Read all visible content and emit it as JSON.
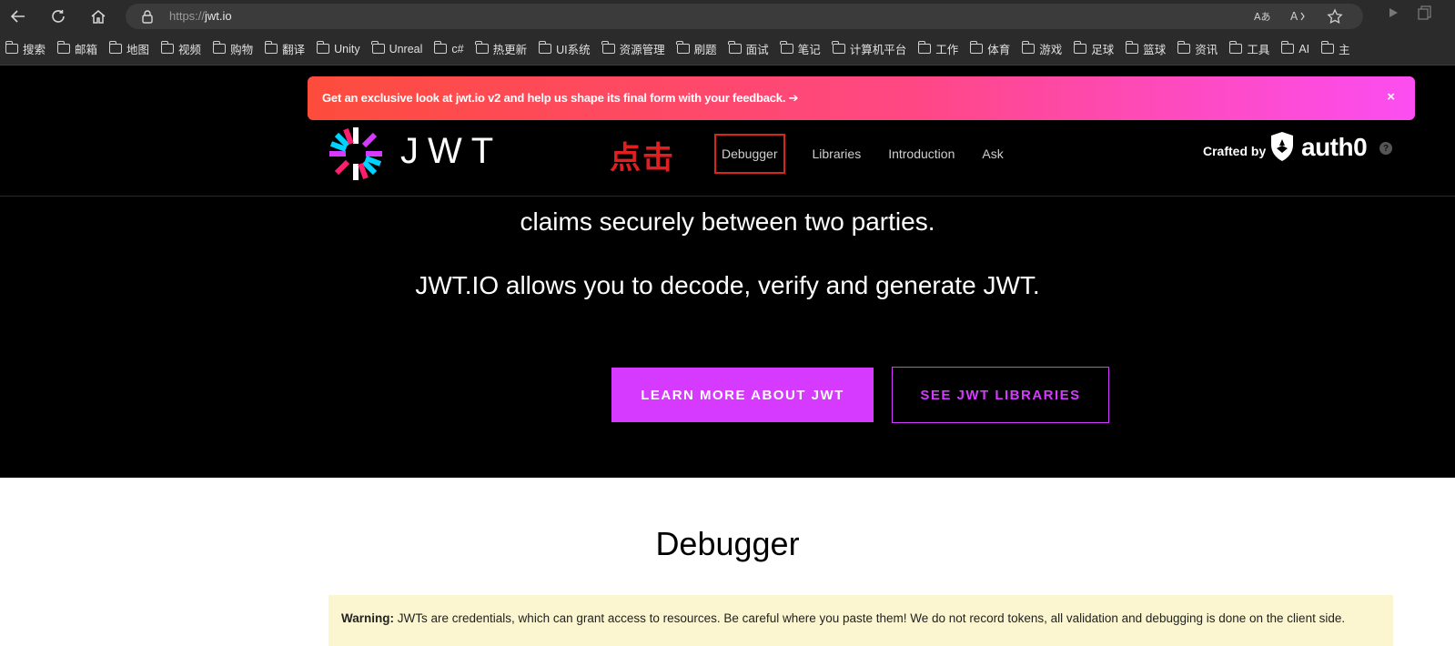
{
  "browser": {
    "url_protocol": "https://",
    "url_host": "jwt.io",
    "bookmarks": [
      "搜索",
      "邮箱",
      "地图",
      "视频",
      "购物",
      "翻译",
      "Unity",
      "Unreal",
      "c#",
      "热更新",
      "UI系统",
      "资源管理",
      "刷题",
      "面试",
      "笔记",
      "计算机平台",
      "工作",
      "体育",
      "游戏",
      "足球",
      "篮球",
      "资讯",
      "工具",
      "AI",
      "主"
    ]
  },
  "banner": {
    "text": "Get an exclusive look at jwt.io v2 and help us shape its final form with your feedback.",
    "arrow": "➔",
    "close": "×"
  },
  "header": {
    "logo_text": "JWT",
    "annotation": "点击",
    "nav": [
      "Debugger",
      "Libraries",
      "Introduction",
      "Ask"
    ],
    "crafted_by": "Crafted by",
    "brand": "auth0",
    "help": "?"
  },
  "hero": {
    "line1": "claims securely between two parties.",
    "line2": "JWT.IO allows you to decode, verify and generate JWT.",
    "primary_button": "LEARN MORE ABOUT JWT",
    "secondary_button": "SEE JWT LIBRARIES"
  },
  "debugger": {
    "title": "Debugger",
    "warning_label": "Warning:",
    "warning_text": "JWTs are credentials, which can grant access to resources. Be careful where you paste them! We do not record tokens, all validation and debugging is done on the client side."
  },
  "colors": {
    "accent": "#d63aff",
    "annotation_red": "#e02020",
    "banner_start": "#fd4c3c",
    "banner_end": "#fc4df2"
  }
}
